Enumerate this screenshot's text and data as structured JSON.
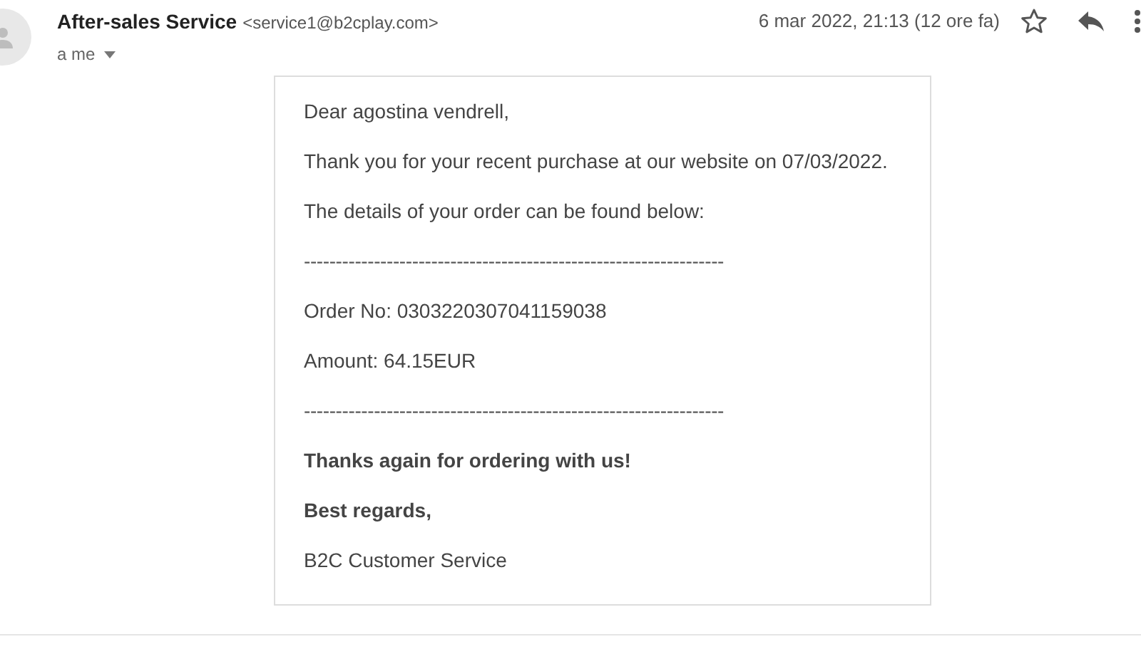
{
  "header": {
    "sender_name": "After-sales Service",
    "sender_email": "<service1@b2cplay.com>",
    "recipient": "a me",
    "date": "6 mar 2022, 21:13 (12 ore fa)",
    "starred": false
  },
  "body": [
    {
      "kind": "text",
      "text": "Dear agostina vendrell,"
    },
    {
      "kind": "text",
      "text": "Thank you for your recent purchase at our website on 07/03/2022."
    },
    {
      "kind": "text",
      "text": "The details of your order can be found below:"
    },
    {
      "kind": "rule",
      "text": "------------------------------------------------------------------"
    },
    {
      "kind": "text",
      "text": "Order No: 0303220307041159038"
    },
    {
      "kind": "text",
      "text": "Amount: 64.15EUR"
    },
    {
      "kind": "rule",
      "text": "------------------------------------------------------------------"
    },
    {
      "kind": "bold",
      "text": "Thanks again for ordering with us!"
    },
    {
      "kind": "bold",
      "text": "Best regards,"
    },
    {
      "kind": "text",
      "text": "B2C Customer Service"
    }
  ]
}
